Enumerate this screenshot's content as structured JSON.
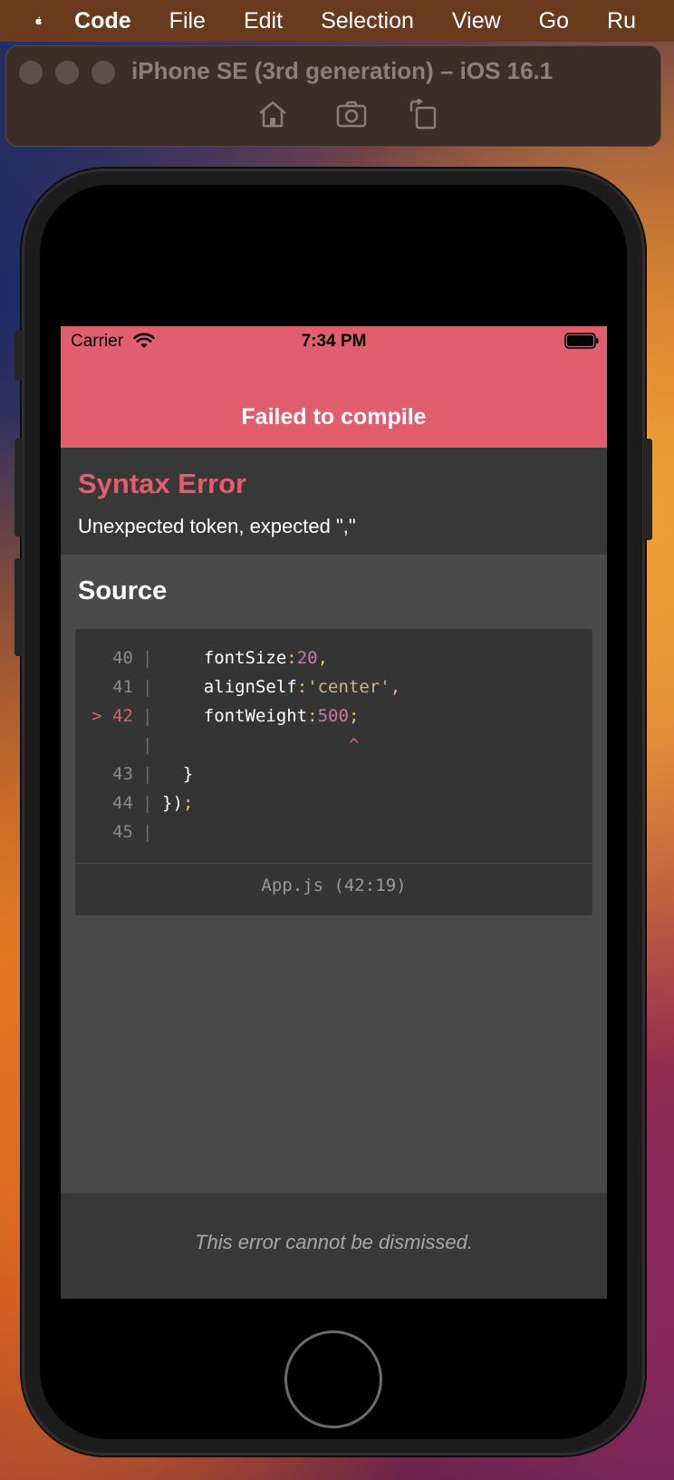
{
  "menubar": {
    "items": [
      "Code",
      "File",
      "Edit",
      "Selection",
      "View",
      "Go",
      "Ru"
    ]
  },
  "simulator": {
    "title": "iPhone SE (3rd generation) – iOS 16.1"
  },
  "status_bar": {
    "carrier": "Carrier",
    "time": "7:34 PM"
  },
  "error_screen": {
    "header": "Failed to compile",
    "error_type": "Syntax Error",
    "error_message": "Unexpected token, expected \",\"",
    "source_title": "Source",
    "code": {
      "lines": [
        {
          "marker": "",
          "number": "40",
          "tokens": [
            {
              "t": "    fontSize",
              "c": "plain"
            },
            {
              "t": ":",
              "c": "punct"
            },
            {
              "t": "20",
              "c": "num"
            },
            {
              "t": ",",
              "c": "punct"
            }
          ]
        },
        {
          "marker": "",
          "number": "41",
          "tokens": [
            {
              "t": "    alignSelf",
              "c": "plain"
            },
            {
              "t": ":",
              "c": "punct"
            },
            {
              "t": "'center'",
              "c": "str"
            },
            {
              "t": ",",
              "c": "punct"
            }
          ]
        },
        {
          "marker": ">",
          "number": "42",
          "tokens": [
            {
              "t": "    fontWeight",
              "c": "plain"
            },
            {
              "t": ":",
              "c": "punct"
            },
            {
              "t": "500",
              "c": "num"
            },
            {
              "t": ";",
              "c": "punct"
            }
          ]
        },
        {
          "marker": "",
          "number": "",
          "tokens": [
            {
              "t": "                  ^",
              "c": "caret"
            }
          ]
        },
        {
          "marker": "",
          "number": "43",
          "tokens": [
            {
              "t": "  }",
              "c": "plain"
            }
          ]
        },
        {
          "marker": "",
          "number": "44",
          "tokens": [
            {
              "t": "})",
              "c": "plain"
            },
            {
              "t": ";",
              "c": "punct"
            }
          ]
        },
        {
          "marker": "",
          "number": "45",
          "tokens": []
        }
      ],
      "file_ref": "App.js (42:19)"
    },
    "footer": "This error cannot be dismissed."
  },
  "colors": {
    "accent_red": "#e05e6d",
    "number_token": "#c97aa6",
    "string_token": "#c4b88a",
    "punct_token": "#e8c45a"
  }
}
